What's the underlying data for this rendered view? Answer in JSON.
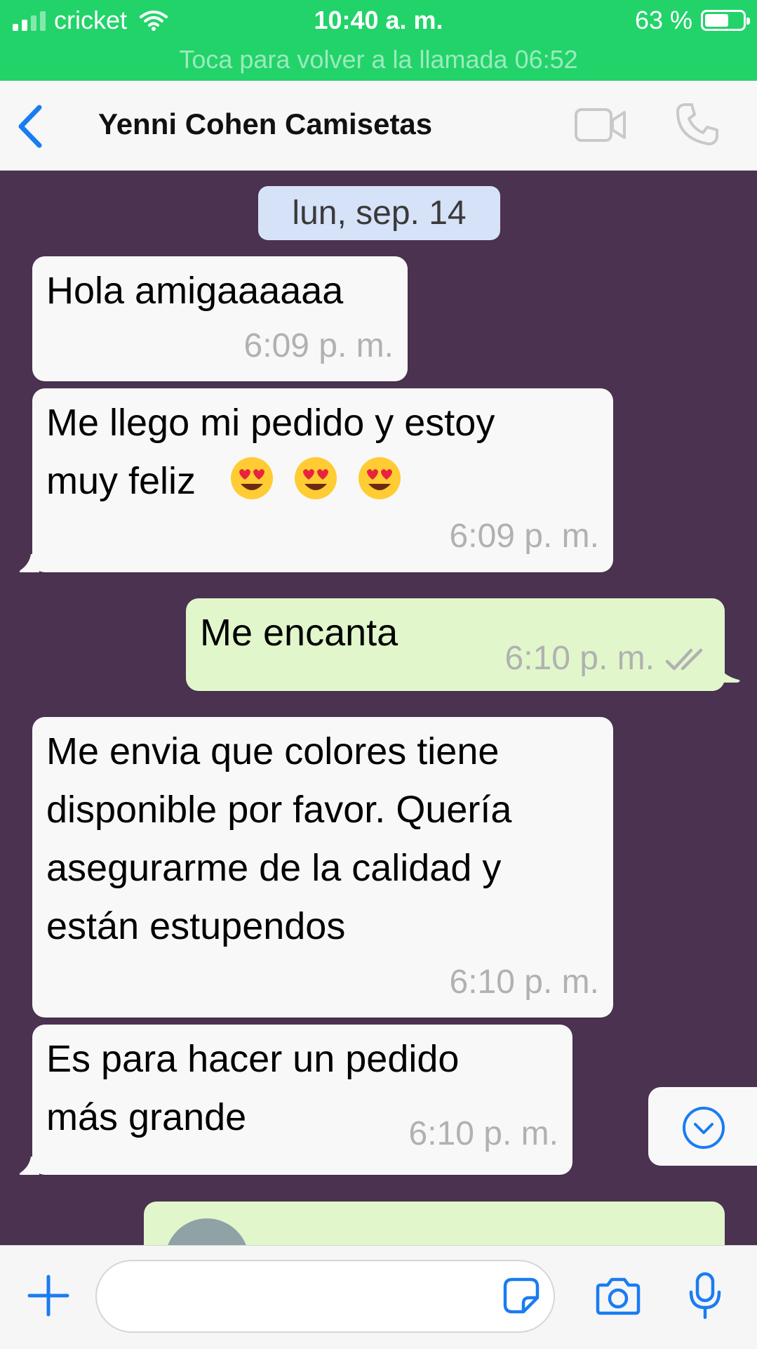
{
  "status_bar": {
    "carrier": "cricket",
    "time": "10:40 a. m.",
    "battery": "63 %",
    "battery_level": 0.63,
    "call_banner": "Toca para volver a la llamada 06:52",
    "background_color": "#22d36a"
  },
  "header": {
    "title": "Yenni Cohen Camisetas",
    "accent_color": "#1a7cf2",
    "icons": [
      "back-chevron-icon",
      "video-call-icon",
      "phone-call-icon"
    ]
  },
  "chat": {
    "background_color": "#4a3250",
    "date_label": "lun, sep. 14",
    "messages": [
      {
        "direction": "in",
        "text": "Hola amigaaaaaa",
        "time": "6:09 p. m."
      },
      {
        "direction": "in",
        "line1": "Me llego mi pedido y estoy",
        "line2": "muy feliz",
        "emojis": [
          "heart-eyes-emoji",
          "heart-eyes-emoji",
          "heart-eyes-emoji"
        ],
        "time": "6:09 p. m."
      },
      {
        "direction": "out",
        "text": "Me encanta",
        "time": "6:10 p. m.",
        "status": "read-double-check"
      },
      {
        "direction": "in",
        "lines": [
          "Me envia que colores tiene",
          "disponible por favor. Quería",
          "asegurarme de la calidad y",
          "están estupendos"
        ],
        "time": "6:10 p. m."
      },
      {
        "direction": "in",
        "lines": [
          "Es para hacer un pedido",
          "más grande"
        ],
        "time": "6:10 p. m."
      }
    ]
  },
  "input_bar": {
    "message_value": "",
    "icons": [
      "plus-icon",
      "sticker-icon",
      "camera-icon",
      "microphone-icon",
      "scroll-down-icon"
    ]
  }
}
